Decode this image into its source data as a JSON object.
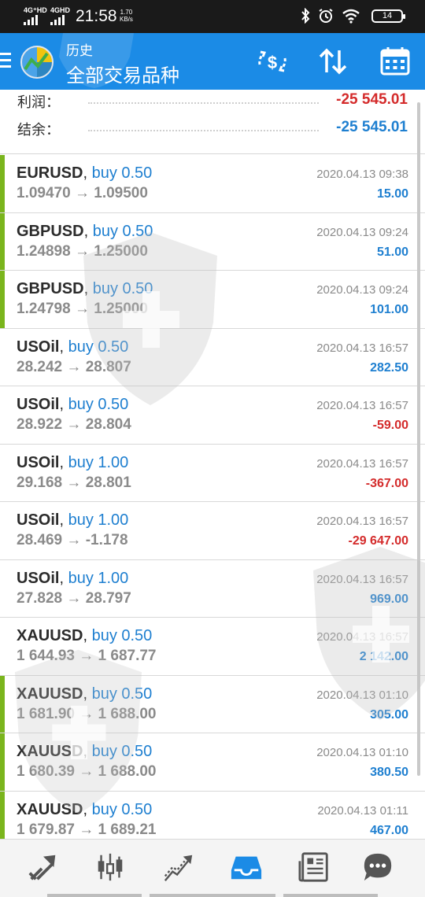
{
  "status_bar": {
    "network1": "4G⁺HD",
    "network2": "4GHD",
    "time": "21:58",
    "speed_value": "1.70",
    "speed_unit": "KB/s",
    "battery": "14"
  },
  "header": {
    "subtitle": "历史",
    "title": "全部交易品种",
    "icons": [
      "menu-icon",
      "metatrader-logo",
      "currency-exchange-icon",
      "sort-icon",
      "calendar-icon"
    ]
  },
  "summary": {
    "profit_label": "利润：",
    "profit_value": "-25 545.01",
    "balance_label": "结余：",
    "balance_value": "-25 545.01"
  },
  "trades": [
    {
      "symbol": "EURUSD",
      "action": "buy 0.50",
      "open": "1.09470",
      "close": "1.09500",
      "time": "2020.04.13 09:38",
      "profit": "15.00"
    },
    {
      "symbol": "GBPUSD",
      "action": "buy 0.50",
      "open": "1.24898",
      "close": "1.25000",
      "time": "2020.04.13 09:24",
      "profit": "51.00"
    },
    {
      "symbol": "GBPUSD",
      "action": "buy 0.50",
      "open": "1.24798",
      "close": "1.25000",
      "time": "2020.04.13 09:24",
      "profit": "101.00"
    },
    {
      "symbol": "USOil",
      "action": "buy 0.50",
      "open": "28.242",
      "close": "28.807",
      "time": "2020.04.13 16:57",
      "profit": "282.50"
    },
    {
      "symbol": "USOil",
      "action": "buy 0.50",
      "open": "28.922",
      "close": "28.804",
      "time": "2020.04.13 16:57",
      "profit": "-59.00"
    },
    {
      "symbol": "USOil",
      "action": "buy 1.00",
      "open": "29.168",
      "close": "28.801",
      "time": "2020.04.13 16:57",
      "profit": "-367.00"
    },
    {
      "symbol": "USOil",
      "action": "buy 1.00",
      "open": "28.469",
      "close": "-1.178",
      "time": "2020.04.13 16:57",
      "profit": "-29 647.00"
    },
    {
      "symbol": "USOil",
      "action": "buy 1.00",
      "open": "27.828",
      "close": "28.797",
      "time": "2020.04.13 16:57",
      "profit": "969.00"
    },
    {
      "symbol": "XAUUSD",
      "action": "buy 0.50",
      "open": "1 644.93",
      "close": "1 687.77",
      "time": "2020.04.13 16:57",
      "profit": "2 142.00"
    },
    {
      "symbol": "XAUUSD",
      "action": "buy 0.50",
      "open": "1 681.90",
      "close": "1 688.00",
      "time": "2020.04.13 01:10",
      "profit": "305.00"
    },
    {
      "symbol": "XAUUSD",
      "action": "buy 0.50",
      "open": "1 680.39",
      "close": "1 688.00",
      "time": "2020.04.13 01:10",
      "profit": "380.50"
    },
    {
      "symbol": "XAUUSD",
      "action": "buy 0.50",
      "open": "1 679.87",
      "close": "1 689.21",
      "time": "2020.04.13 01:11",
      "profit": "467.00"
    }
  ],
  "price_arrow": "→",
  "bottom_nav": [
    "quotes-icon",
    "chart-icon",
    "trade-icon",
    "history-icon",
    "news-icon",
    "chat-icon"
  ],
  "colors": {
    "accent": "#1b8be6",
    "positive": "#1e7fd0",
    "negative": "#d42b2b",
    "mark": "#7ab51d"
  }
}
